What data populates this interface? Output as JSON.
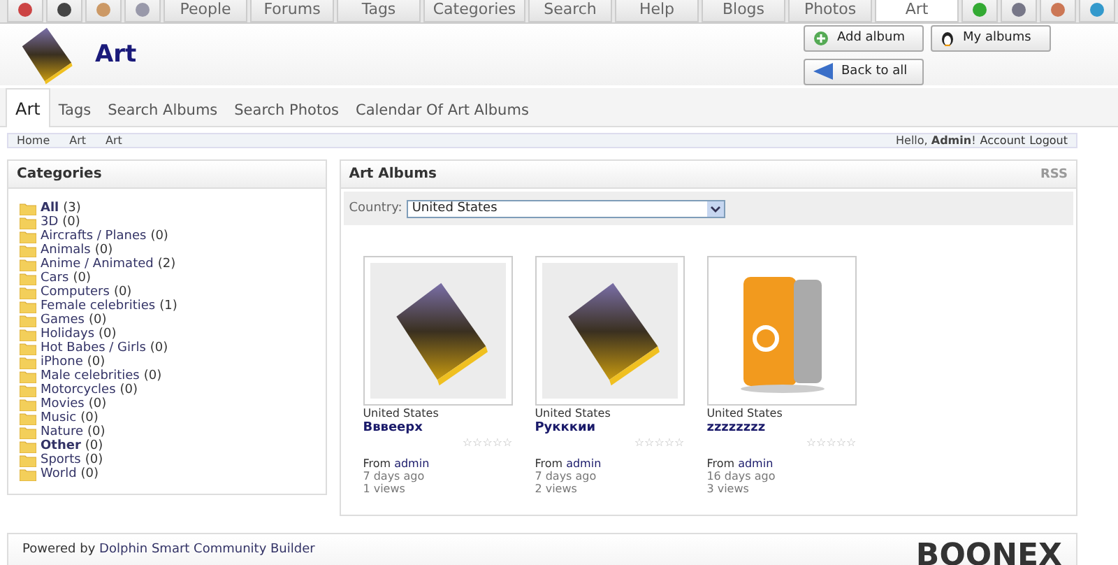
{
  "top_nav": [
    {
      "kind": "icon",
      "selected": false
    },
    {
      "kind": "icon",
      "selected": false
    },
    {
      "kind": "icon",
      "selected": false
    },
    {
      "kind": "icon",
      "selected": false
    },
    {
      "kind": "text",
      "label": "People",
      "selected": false
    },
    {
      "kind": "text",
      "label": "Forums",
      "selected": false
    },
    {
      "kind": "text",
      "label": "Tags",
      "selected": false
    },
    {
      "kind": "text",
      "label": "Categories",
      "selected": false
    },
    {
      "kind": "text",
      "label": "Search",
      "selected": false
    },
    {
      "kind": "text",
      "label": "Help",
      "selected": false
    },
    {
      "kind": "text",
      "label": "Blogs",
      "selected": false
    },
    {
      "kind": "text",
      "label": "Photos",
      "selected": false
    },
    {
      "kind": "text",
      "label": "Art",
      "selected": true
    },
    {
      "kind": "icon",
      "selected": false
    },
    {
      "kind": "icon",
      "selected": false
    },
    {
      "kind": "icon",
      "selected": false
    },
    {
      "kind": "icon",
      "selected": false
    }
  ],
  "header": {
    "title": "Art",
    "buttons": [
      {
        "kind": "add",
        "label": "Add album"
      },
      {
        "kind": "user",
        "label": "My albums"
      },
      {
        "kind": "back",
        "label": "Back to all"
      }
    ]
  },
  "sub_tabs": [
    {
      "label": "Art",
      "selected": true
    },
    {
      "label": "Tags",
      "selected": false
    },
    {
      "label": "Search Albums",
      "selected": false
    },
    {
      "label": "Search Photos",
      "selected": false
    },
    {
      "label": "Calendar Of Art Albums",
      "selected": false
    }
  ],
  "breadcrumb": [
    "Home",
    "Art",
    "Art"
  ],
  "account": {
    "greeting": "Hello, **Admin**!",
    "links": [
      "Account",
      "Logout"
    ]
  },
  "categories": {
    "title": "Categories",
    "items": [
      {
        "name": "All",
        "count": "(3)",
        "bold": true
      },
      {
        "name": "3D",
        "count": "(0)",
        "bold": false
      },
      {
        "name": "Aircrafts / Planes",
        "count": "(0)",
        "bold": false
      },
      {
        "name": "Animals",
        "count": "(0)",
        "bold": false
      },
      {
        "name": "Anime / Animated",
        "count": "(2)",
        "bold": false
      },
      {
        "name": "Cars",
        "count": "(0)",
        "bold": false
      },
      {
        "name": "Computers",
        "count": "(0)",
        "bold": false
      },
      {
        "name": "Female celebrities",
        "count": "(1)",
        "bold": false
      },
      {
        "name": "Games",
        "count": "(0)",
        "bold": false
      },
      {
        "name": "Holidays",
        "count": "(0)",
        "bold": false
      },
      {
        "name": "Hot Babes / Girls",
        "count": "(0)",
        "bold": false
      },
      {
        "name": "iPhone",
        "count": "(0)",
        "bold": false
      },
      {
        "name": "Male celebrities",
        "count": "(0)",
        "bold": false
      },
      {
        "name": "Motorcycles",
        "count": "(0)",
        "bold": false
      },
      {
        "name": "Movies",
        "count": "(0)",
        "bold": false
      },
      {
        "name": "Music",
        "count": "(0)",
        "bold": false
      },
      {
        "name": "Nature",
        "count": "(0)",
        "bold": false
      },
      {
        "name": "Other",
        "count": "(0)",
        "bold": true
      },
      {
        "name": "Sports",
        "count": "(0)",
        "bold": false
      },
      {
        "name": "World",
        "count": "(0)",
        "bold": false
      }
    ]
  },
  "albums": {
    "title": "Art Albums",
    "rss": "RSS",
    "country_label": "Country:",
    "country_value": "United States",
    "items": [
      {
        "kind": "folder",
        "country": "United States",
        "title": "Вввеерх",
        "stars": 0,
        "from": "From",
        "author": "admin",
        "age": "7 days ago",
        "views": "1 views"
      },
      {
        "kind": "folder",
        "country": "United States",
        "title": "Рукккии",
        "stars": 0,
        "from": "From",
        "author": "admin",
        "age": "7 days ago",
        "views": "2 views"
      },
      {
        "kind": "device",
        "country": "United States",
        "title": "zzzzzzzz",
        "stars": 0,
        "from": "From",
        "author": "admin",
        "age": "16 days ago",
        "views": "3 views"
      }
    ]
  },
  "footer": {
    "prefix": "Powered by",
    "link": "Dolphin Smart Community Builder",
    "logo": "BOONEX"
  }
}
